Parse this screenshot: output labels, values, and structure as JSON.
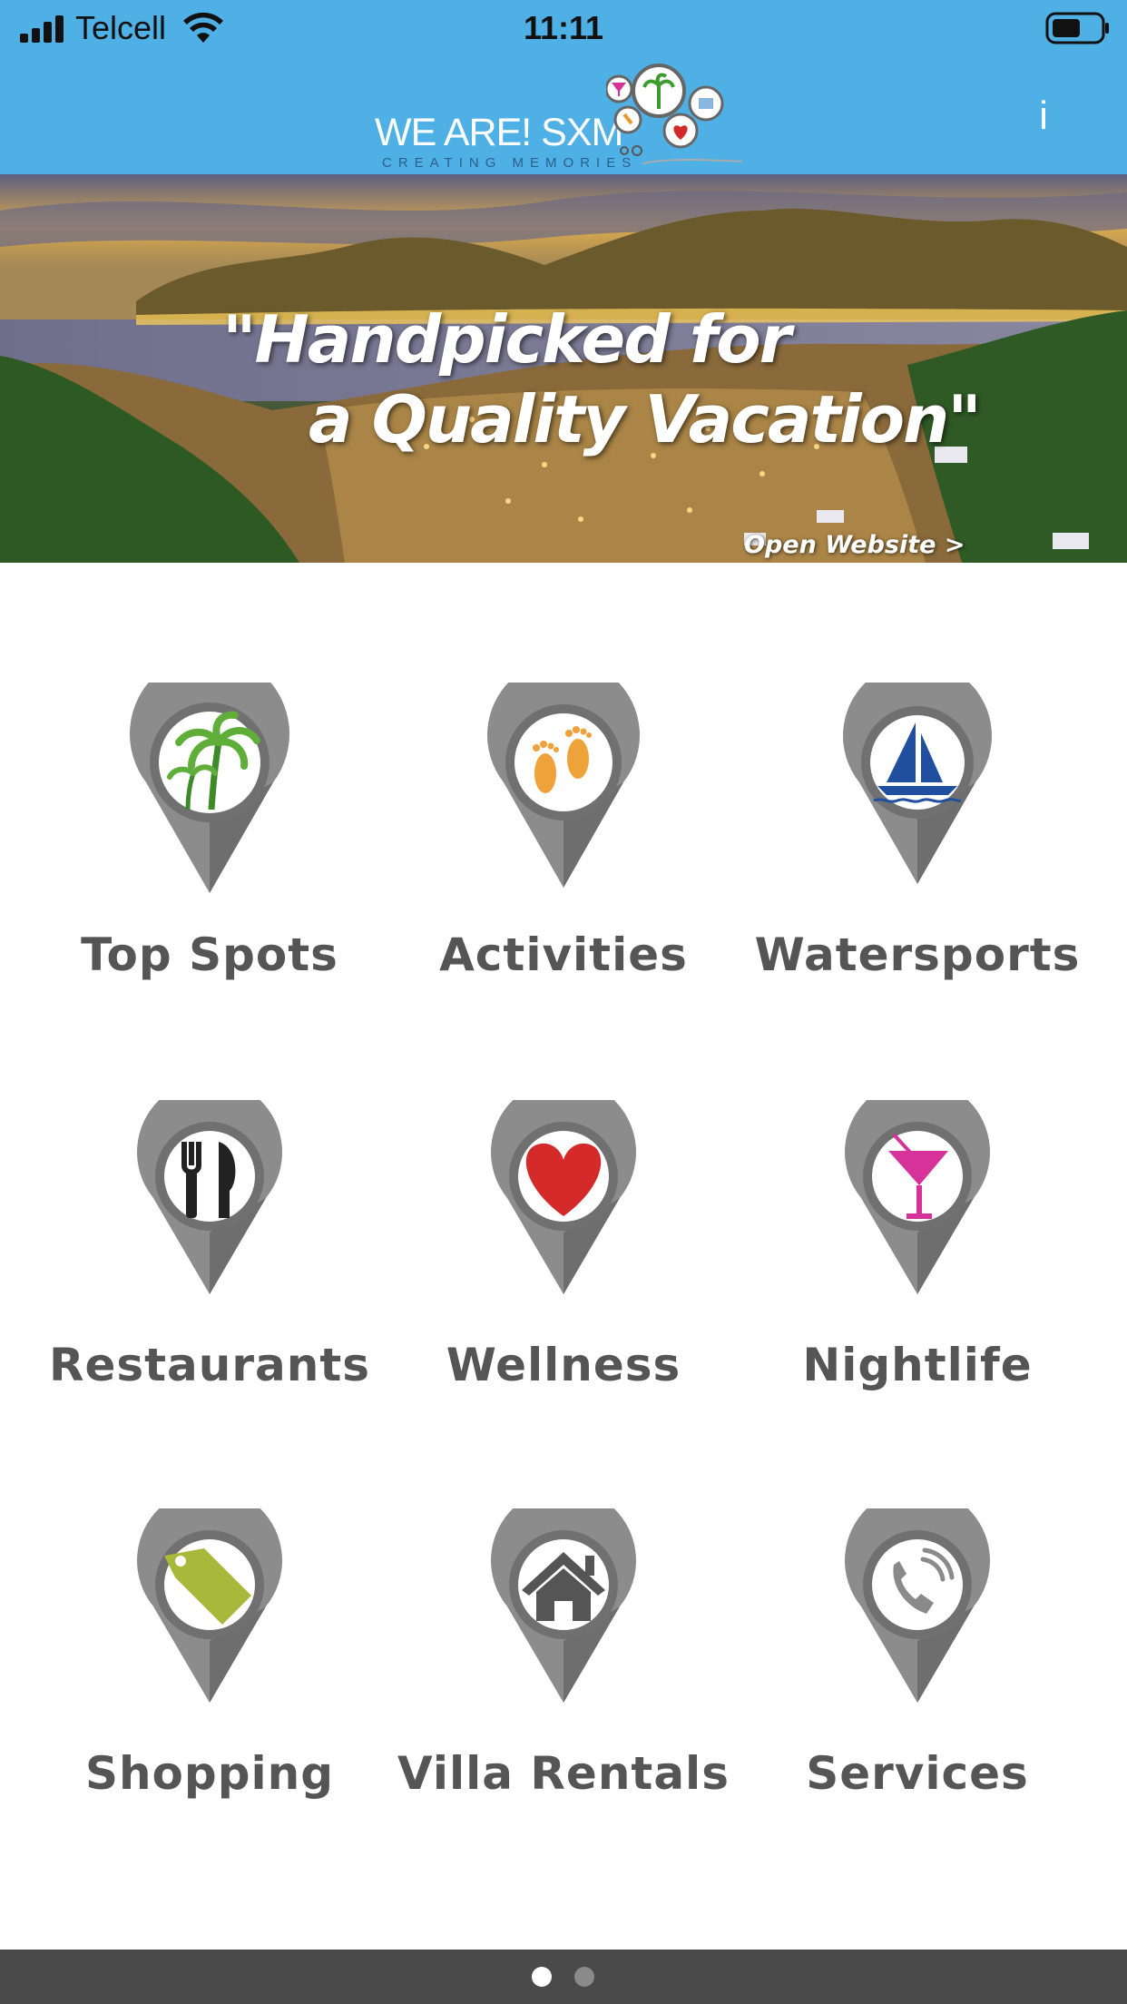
{
  "status_bar": {
    "carrier": "Telcell",
    "time": "11:11",
    "icons": [
      "signal-icon",
      "wifi-icon",
      "battery-icon"
    ]
  },
  "header": {
    "logo_text": "WE ARE! SXM",
    "logo_tagline": "CREATING MEMORIES",
    "info_label": "i",
    "background_color": "#4fb0e6"
  },
  "banner": {
    "headline_line1": "\"Handpicked for",
    "headline_line2": "a Quality Vacation\"",
    "link_label": "Open Website >"
  },
  "categories": [
    {
      "label": "Top Spots",
      "icon": "palm-tree-icon"
    },
    {
      "label": "Activities",
      "icon": "footprints-icon"
    },
    {
      "label": "Watersports",
      "icon": "sailboat-icon"
    },
    {
      "label": "Restaurants",
      "icon": "fork-knife-icon"
    },
    {
      "label": "Wellness",
      "icon": "heart-icon"
    },
    {
      "label": "Nightlife",
      "icon": "cocktail-icon"
    },
    {
      "label": "Shopping",
      "icon": "price-tag-icon"
    },
    {
      "label": "Villa Rentals",
      "icon": "house-icon"
    },
    {
      "label": "Services",
      "icon": "phone-icon"
    }
  ],
  "pager": {
    "page_count": 2,
    "active_page": 1
  }
}
